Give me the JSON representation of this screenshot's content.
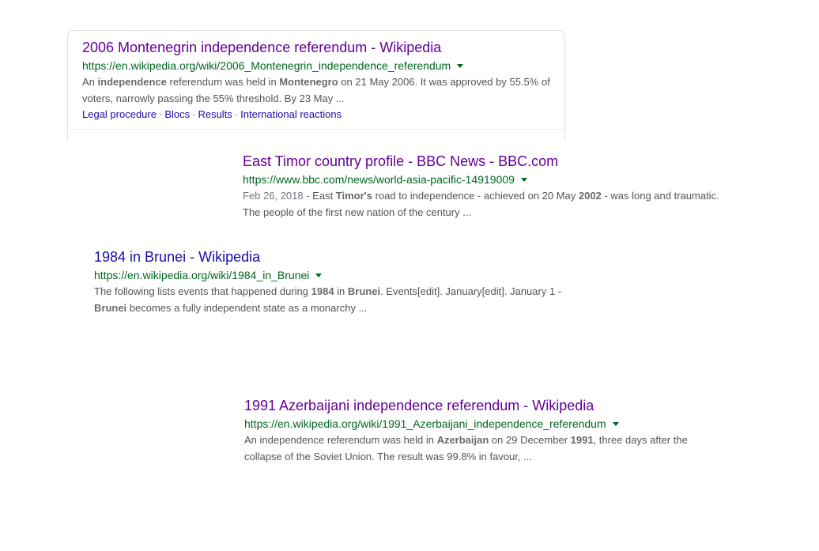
{
  "results": [
    {
      "title": "2006 Montenegrin independence referendum - Wikipedia",
      "url": "https://en.wikipedia.org/wiki/2006_Montenegrin_independence_referendum",
      "snippet": [
        {
          "t": "An "
        },
        {
          "t": "independence",
          "b": true
        },
        {
          "t": " referendum was held in "
        },
        {
          "t": "Montenegro",
          "b": true
        },
        {
          "t": " on 21 May 2006. It was approved by 55.5% of"
        }
      ],
      "snippet2": "voters, narrowly passing the 55% threshold. By 23 May ...",
      "sitelinks": [
        "Legal procedure",
        "Blocs",
        "Results",
        "International reactions"
      ],
      "sitelink_separator": "·"
    },
    {
      "title": "East Timor country profile - BBC News - BBC.com",
      "url": "https://www.bbc.com/news/world-asia-pacific-14919009",
      "date": "Feb 26, 2018 - ",
      "snippet": [
        {
          "t": "East "
        },
        {
          "t": "Timor's",
          "b": true
        },
        {
          "t": " road to independence - achieved on 20 May "
        },
        {
          "t": "2002",
          "b": true
        },
        {
          "t": " - was long and traumatic."
        }
      ],
      "snippet2": "The people of the first new nation of the century ..."
    },
    {
      "title": "1984 in Brunei - Wikipedia",
      "url": "https://en.wikipedia.org/wiki/1984_in_Brunei",
      "snippet": [
        {
          "t": "The following lists events that happened during "
        },
        {
          "t": "1984",
          "b": true
        },
        {
          "t": " in "
        },
        {
          "t": "Brunei",
          "b": true
        },
        {
          "t": ". Events[edit]. January[edit]. January 1 -"
        }
      ],
      "snippet2_parts": [
        {
          "t": "Brunei",
          "b": true
        },
        {
          "t": " becomes a fully independent state as a monarchy ..."
        }
      ]
    },
    {
      "title": "1991 Azerbaijani independence referendum - Wikipedia",
      "url": "https://en.wikipedia.org/wiki/1991_Azerbaijani_independence_referendum",
      "snippet": [
        {
          "t": "An independence referendum was held in "
        },
        {
          "t": "Azerbaijan",
          "b": true
        },
        {
          "t": " on 29 December "
        },
        {
          "t": "1991",
          "b": true
        },
        {
          "t": ", three days after the"
        }
      ],
      "snippet2": "collapse of the Soviet Union. The result was 99.8% in favour, ..."
    }
  ],
  "colors": {
    "title_visited": "#660099",
    "title_unvisited": "#1a0dab",
    "url": "#006621",
    "snippet": "#545454"
  },
  "icons": {
    "url_menu": "caret-down-icon"
  }
}
